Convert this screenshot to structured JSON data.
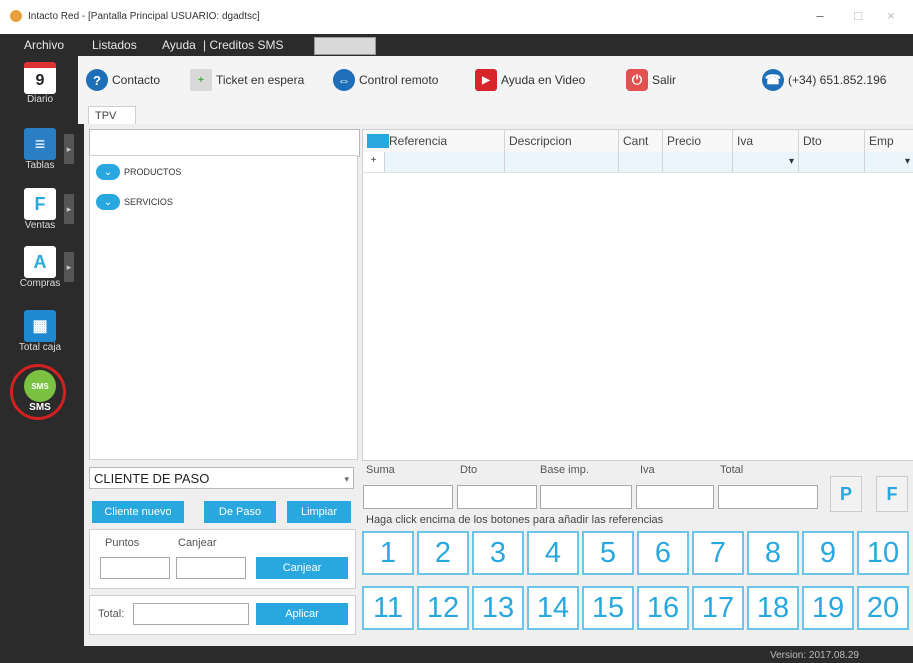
{
  "window": {
    "title": "Intacto Red - [Pantalla Principal USUARIO: dgadtsc]",
    "minimize": "–",
    "maximize": "□",
    "close": "×"
  },
  "menu": {
    "archivo": "Archivo",
    "listados": "Listados",
    "ayuda": "Ayuda",
    "creditos": "| Creditos SMS"
  },
  "sidebar": {
    "items": [
      {
        "label": "Diario",
        "icon": "calendar-icon",
        "glyph": "9"
      },
      {
        "label": "Tablas",
        "icon": "database-icon",
        "glyph": "≡"
      },
      {
        "label": "Ventas",
        "icon": "sales-document-icon",
        "glyph": "F"
      },
      {
        "label": "Compras",
        "icon": "purchases-document-icon",
        "glyph": "A"
      },
      {
        "label": "Total caja",
        "icon": "calculator-icon",
        "glyph": "▦"
      },
      {
        "label": "SMS",
        "icon": "sms-bubble-icon",
        "glyph": "SMS"
      }
    ]
  },
  "toolbar": {
    "contacto": "Contacto",
    "ticket": "Ticket en espera",
    "control": "Control remoto",
    "video": "Ayuda en Video",
    "salir": "Salir",
    "phone": "(+34) 651.852.196"
  },
  "tabs": {
    "tpv": "TPV"
  },
  "tree": {
    "productos": "PRODUCTOS",
    "servicios": "SERVICIOS"
  },
  "grid": {
    "columns": [
      "Referencia",
      "Descripcion",
      "Cant",
      "Precio",
      "Iva",
      "Dto",
      "Emp"
    ],
    "row_marker": "+",
    "dropdown_mark": "▾"
  },
  "customer": {
    "selected": "CLIENTE DE PASO",
    "nuevo": "Cliente nuevo",
    "paso": "De Paso",
    "limpiar": "Limpiar",
    "puntos": "Puntos",
    "canjear_label": "Canjear",
    "canjear_btn": "Canjear",
    "total_label": "Total:",
    "aplicar": "Aplicar"
  },
  "totals": {
    "suma": "Suma",
    "dto": "Dto",
    "base": "Base imp.",
    "iva": "Iva",
    "total": "Total"
  },
  "hint": "Haga click encima de los botones para añadir las referencias",
  "quick_buttons": [
    "1",
    "2",
    "3",
    "4",
    "5",
    "6",
    "7",
    "8",
    "9",
    "10",
    "11",
    "12",
    "13",
    "14",
    "15",
    "16",
    "17",
    "18",
    "19",
    "20"
  ],
  "side_buttons": {
    "p": "P",
    "f": "F"
  },
  "version": "Version: 2017.08.29",
  "colors": {
    "accent": "#29a8e0",
    "dark": "#2b2b2b"
  }
}
